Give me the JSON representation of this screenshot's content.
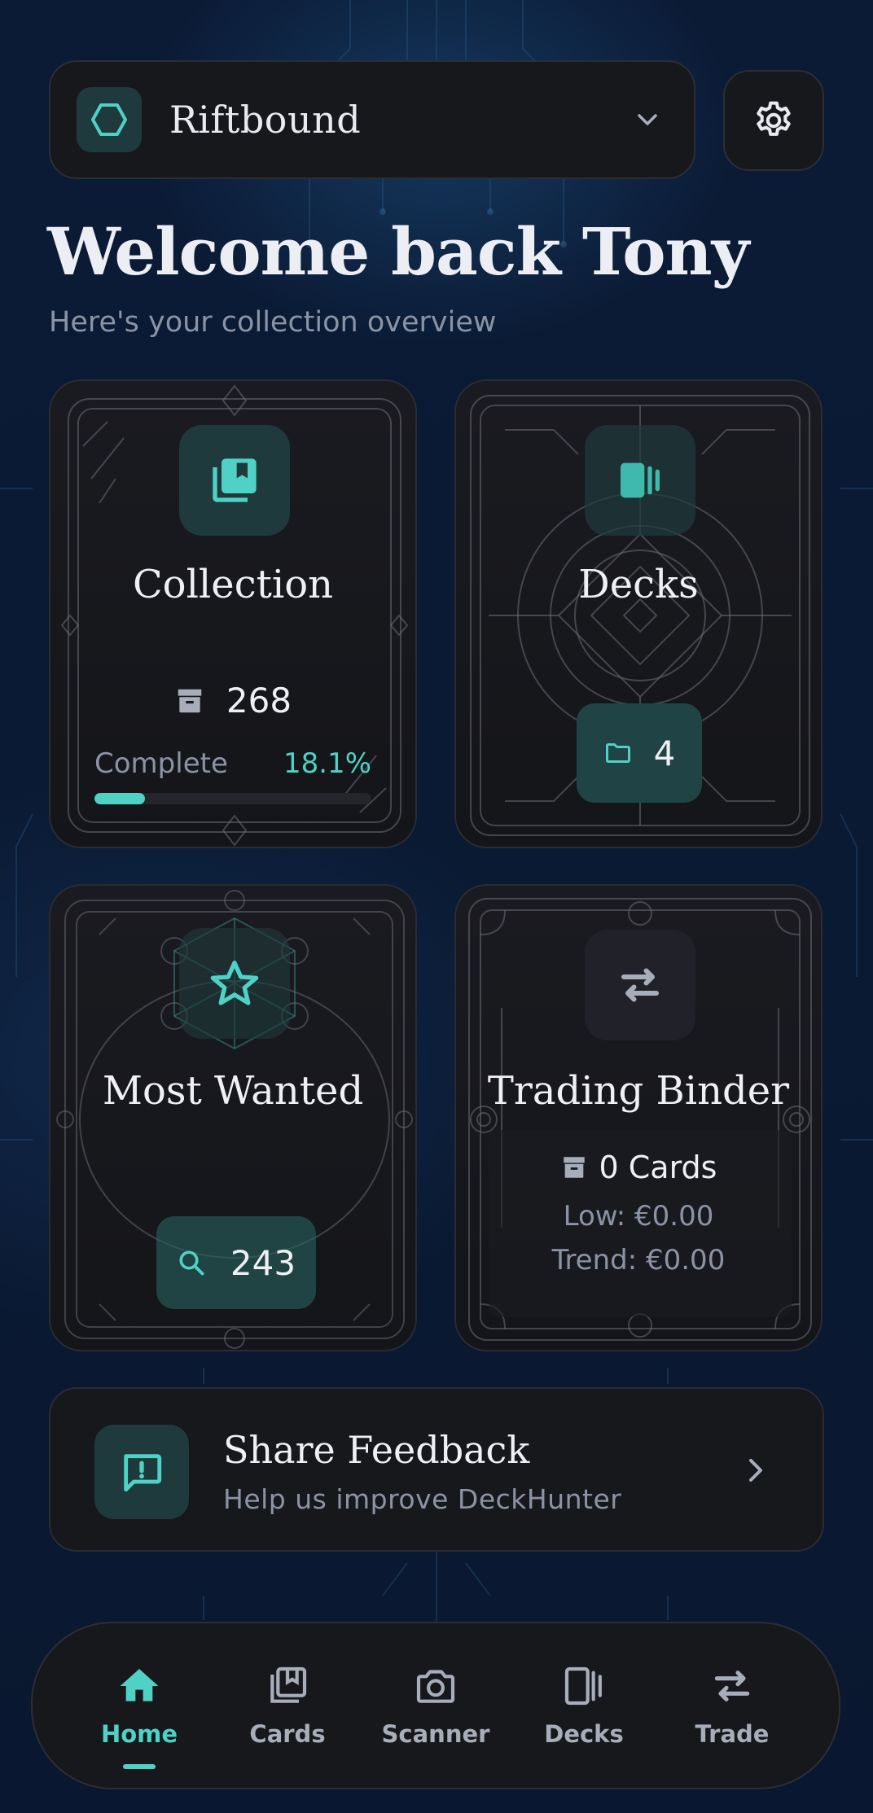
{
  "header": {
    "game_name": "Riftbound"
  },
  "welcome": {
    "title": "Welcome back Tony",
    "subtitle": "Here's your collection overview"
  },
  "tiles": {
    "collection": {
      "title": "Collection",
      "count": "268",
      "complete_label": "Complete",
      "complete_pct": "18.1%",
      "progress": 0.181
    },
    "decks": {
      "title": "Decks",
      "count": "4"
    },
    "most_wanted": {
      "title": "Most Wanted",
      "count": "243"
    },
    "trading_binder": {
      "title": "Trading Binder",
      "cards": "0 Cards",
      "low": "Low: €0.00",
      "trend": "Trend: €0.00"
    }
  },
  "feedback": {
    "title": "Share Feedback",
    "subtitle": "Help us improve DeckHunter"
  },
  "nav": {
    "items": [
      {
        "label": "Home",
        "icon": "home-icon",
        "active": true
      },
      {
        "label": "Cards",
        "icon": "cards-icon",
        "active": false
      },
      {
        "label": "Scanner",
        "icon": "camera-icon",
        "active": false
      },
      {
        "label": "Decks",
        "icon": "decks-icon",
        "active": false
      },
      {
        "label": "Trade",
        "icon": "swap-icon",
        "active": false
      }
    ]
  },
  "colors": {
    "accent": "#4fd1c5",
    "surface": "#17181c",
    "background": "#0a1a33",
    "muted_text": "#8b93a4"
  }
}
